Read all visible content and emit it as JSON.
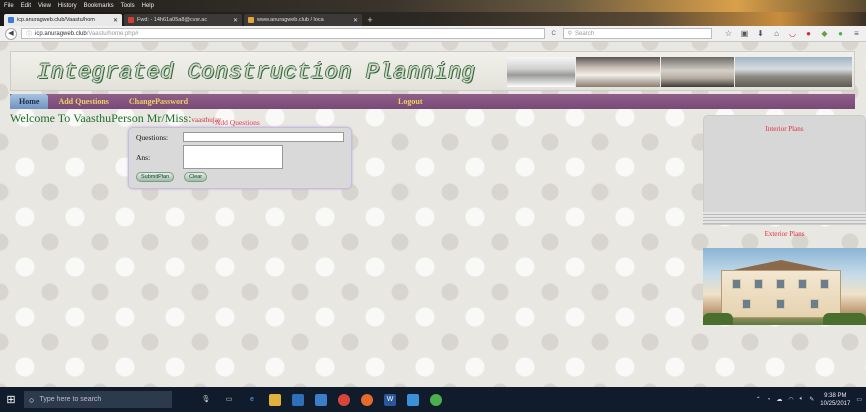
{
  "browser": {
    "menu": [
      "File",
      "Edit",
      "View",
      "History",
      "Bookmarks",
      "Tools",
      "Help"
    ],
    "tabs": [
      {
        "label": "icp.anuragweb.club/Vaastu/hom",
        "active": true,
        "color": "#3b7bd8"
      },
      {
        "label": "Fwd: - 14h61a05a8@cvsr.ac",
        "active": false,
        "color": "#d23f31"
      },
      {
        "label": "www.anuragweb.club / loca",
        "active": false,
        "color": "#e8a33c"
      }
    ],
    "url_host": "icp.anuragweb.club",
    "url_path": "/Vaastu/home.php#",
    "search_placeholder": "Search"
  },
  "header": {
    "site_title": "Integrated Construction Planning"
  },
  "nav": {
    "items": [
      {
        "label": "Home"
      },
      {
        "label": "Add Questions"
      },
      {
        "label": "ChangePassword"
      }
    ],
    "logout": "Logout"
  },
  "welcome": {
    "text": "Welcome To VaasthuPerson Mr/Miss:",
    "user": "vaasthujay"
  },
  "form": {
    "heading": "Add Questions",
    "question_label": "Questions:",
    "answer_label": "Ans:",
    "question_value": "",
    "answer_value": "",
    "submit_label": "SubmitPlan",
    "clear_label": "Clear"
  },
  "sidebar": {
    "interior_heading": "Interior Plans",
    "exterior_heading": "Exterior Plans"
  },
  "taskbar": {
    "search_placeholder": "Type here to search",
    "time": "9:38 PM",
    "date": "10/25/2017"
  }
}
